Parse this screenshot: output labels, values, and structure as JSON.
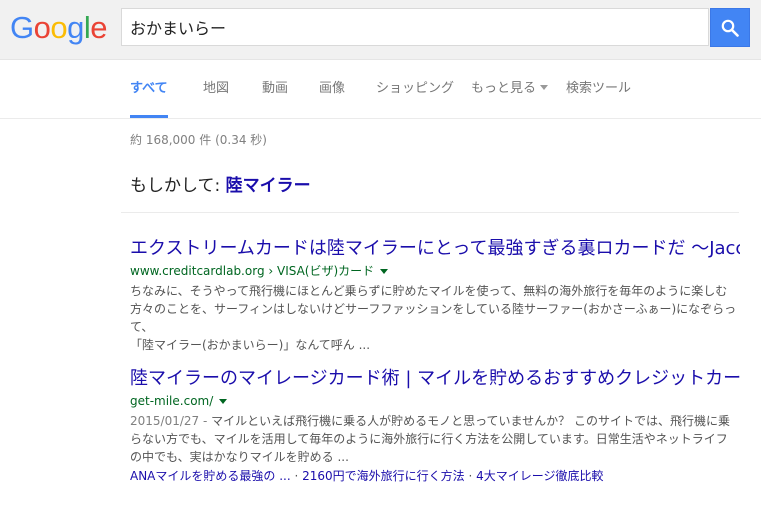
{
  "header": {
    "logo_letters": [
      "G",
      "o",
      "o",
      "g",
      "l",
      "e"
    ],
    "logo_colors": [
      "#4285f4",
      "#ea4335",
      "#fbbc05",
      "#4285f4",
      "#34a853",
      "#ea4335"
    ],
    "search_value": "おかまいらー",
    "search_button_icon": "search-icon"
  },
  "tabs": [
    {
      "label": "すべて",
      "active": true
    },
    {
      "label": "地図"
    },
    {
      "label": "動画"
    },
    {
      "label": "画像"
    },
    {
      "label": "ショッピング"
    },
    {
      "label": "もっと見る",
      "dropdown": true
    },
    {
      "label": "検索ツール"
    }
  ],
  "stats": "約 168,000 件 (0.34 秒)",
  "did_you_mean": {
    "prefix": "もしかして: ",
    "suggestion": "陸マイラー"
  },
  "results": [
    {
      "title": "エクストリームカードは陸マイラーにとって最強すぎる裏ロカードだ 〜Jaccs ...",
      "url": "www.creditcardlab.org › VISA(ビザ)カード",
      "snippet": [
        "ちなみに、そうやって飛行機にほとんど乗らずに貯めたマイルを使って、無料の海外旅行を毎年のように楽しむ",
        "方々のことを、サーフィンはしないけどサーフファッションをしている陸サーファー(おかさーふぁー)になぞらって、",
        "「陸マイラー(おかまいらー)」なんて呼ん ..."
      ]
    },
    {
      "title": "陸マイラーのマイレージカード術 | マイルを貯めるおすすめクレジットカード",
      "url": "get-mile.com/",
      "date": "2015/01/27 - ",
      "snippet": [
        "マイルといえば飛行機に乗る人が貯めるモノと思っていませんか？ このサイトでは、飛行機に乗",
        "らない方でも、マイルを活用して毎年のように海外旅行に行く方法を公開しています。日常生活やネットライフ",
        "の中でも、実はかなりマイルを貯める ..."
      ],
      "sitelinks": [
        "ANAマイルを貯める最強の ...",
        "2160円で海外旅行に行く方法",
        "4大マイレージ徹底比較"
      ],
      "sitelink_separator": " · "
    }
  ]
}
